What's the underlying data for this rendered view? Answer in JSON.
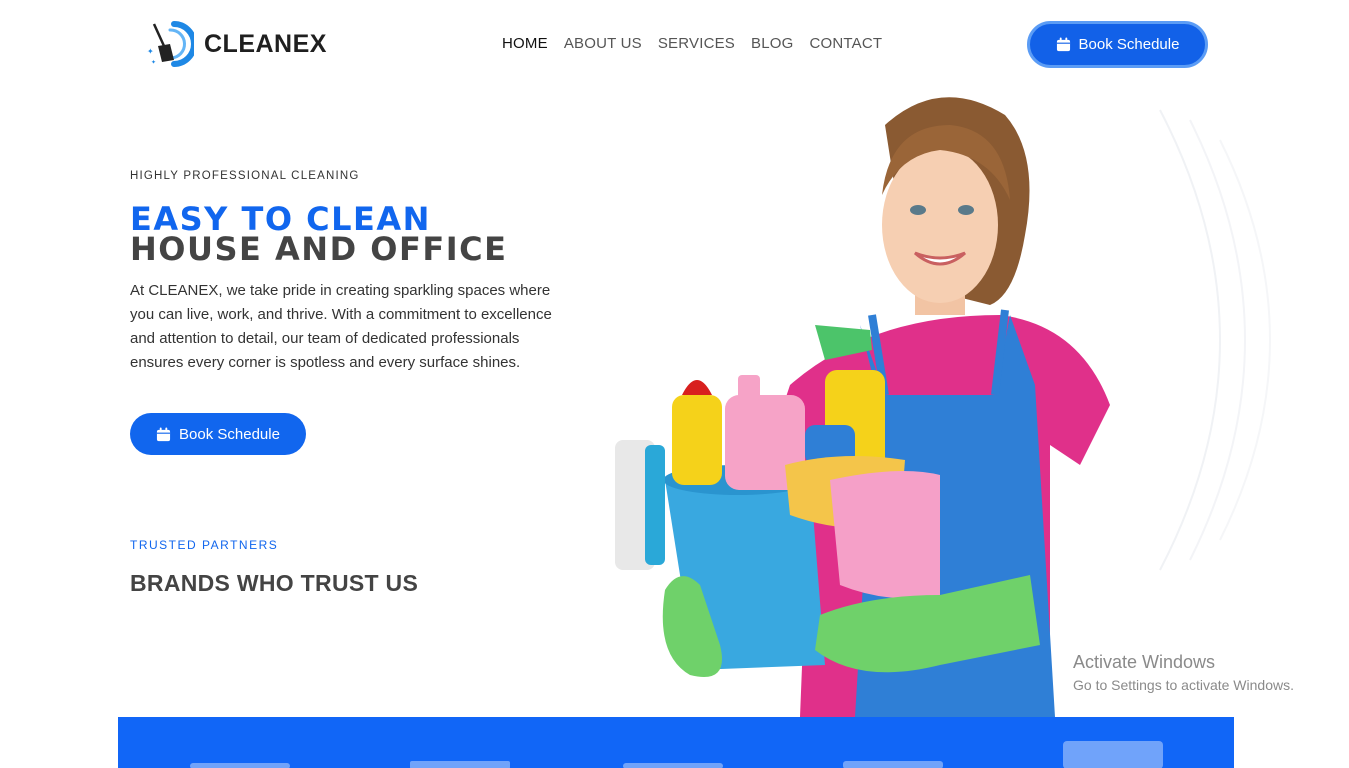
{
  "header": {
    "logo_text": "CLEANEX",
    "nav": [
      {
        "label": "HOME",
        "active": true
      },
      {
        "label": "ABOUT US",
        "active": false
      },
      {
        "label": "SERVICES",
        "active": false
      },
      {
        "label": "BLOG",
        "active": false
      },
      {
        "label": "CONTACT",
        "active": false
      }
    ],
    "book_button": {
      "label": "Book Schedule",
      "icon": "calendar-icon"
    }
  },
  "hero": {
    "eyebrow": "HIGHLY PROFESSIONAL CLEANING",
    "title_line1": "EASY TO CLEAN",
    "title_line2": "HOUSE AND OFFICE",
    "description": "At CLEANEX, we take pride in creating sparkling spaces where you can live, work, and thrive. With a commitment to excellence and attention to detail, our team of dedicated professionals ensures every corner is spotless and every surface shines.",
    "button": {
      "label": "Book Schedule",
      "icon": "calendar-icon"
    }
  },
  "partners": {
    "eyebrow": "TRUSTED PARTNERS",
    "title": "BRANDS WHO TRUST US",
    "logos": [
      "brand-logo-1",
      "brand-logo-2",
      "brand-logo-3",
      "brand-logo-4",
      "brand-logo-5"
    ]
  },
  "watermark": {
    "title": "Activate Windows",
    "subtitle": "Go to Settings to activate Windows."
  },
  "colors": {
    "accent": "#1166ee",
    "brand_strip": "#1166f7",
    "heading_dark": "#444444"
  }
}
